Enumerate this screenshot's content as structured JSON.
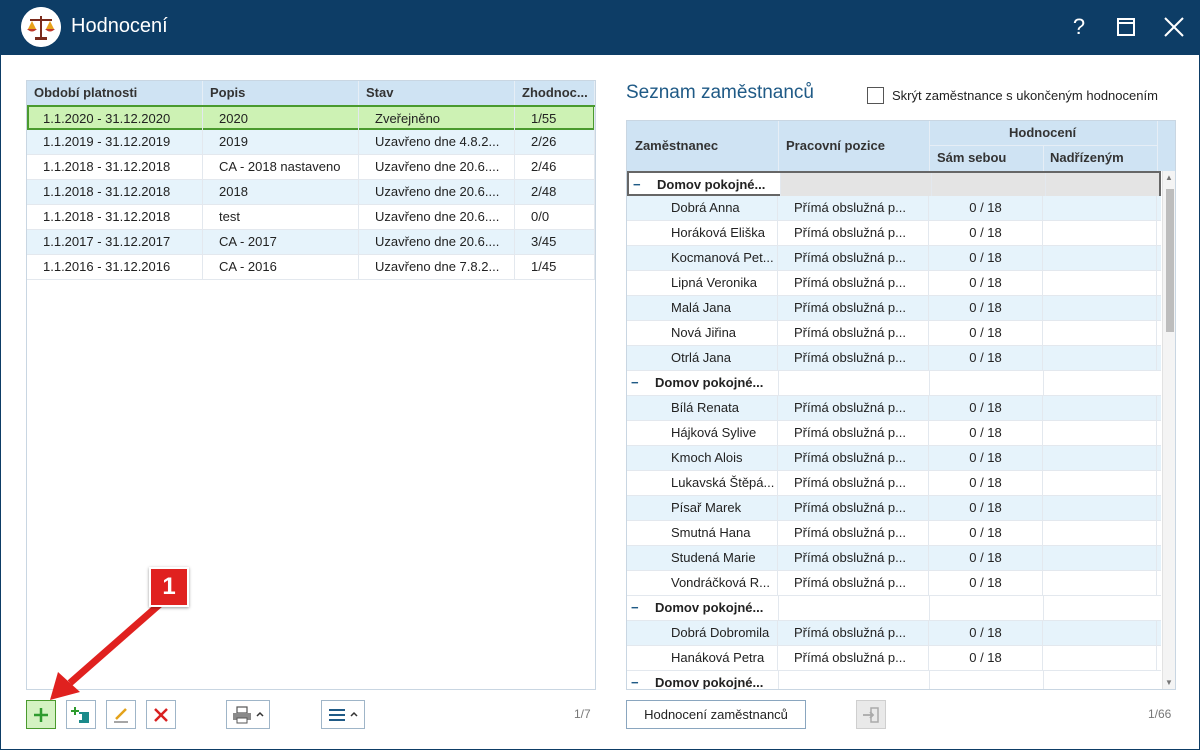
{
  "window": {
    "title": "Hodnocení",
    "help_label": "?",
    "colors": {
      "titlebar": "#0d3d66",
      "accent": "#1f5a86",
      "selected_row": "#cdf2b4",
      "alt_row": "#e6f3fb",
      "annotation": "#e0211f"
    }
  },
  "left_grid": {
    "columns": [
      "Období platnosti",
      "Popis",
      "Stav",
      "Zhodnoc..."
    ],
    "rows": [
      {
        "period": "1.1.2020 - 31.12.2020",
        "desc": "2020",
        "state": "Zveřejněno",
        "score": "1/55"
      },
      {
        "period": "1.1.2019 - 31.12.2019",
        "desc": "2019",
        "state": "Uzavřeno dne 4.8.2...",
        "score": "2/26"
      },
      {
        "period": "1.1.2018 - 31.12.2018",
        "desc": "CA - 2018 nastaveno",
        "state": "Uzavřeno dne 20.6....",
        "score": "2/46"
      },
      {
        "period": "1.1.2018 - 31.12.2018",
        "desc": "2018",
        "state": "Uzavřeno dne 20.6....",
        "score": "2/48"
      },
      {
        "period": "1.1.2018 - 31.12.2018",
        "desc": "test",
        "state": "Uzavřeno dne 20.6....",
        "score": "0/0"
      },
      {
        "period": "1.1.2017 - 31.12.2017",
        "desc": "CA - 2017",
        "state": "Uzavřeno dne 20.6....",
        "score": "3/45"
      },
      {
        "period": "1.1.2016 - 31.12.2016",
        "desc": "CA - 2016",
        "state": "Uzavřeno dne 7.8.2...",
        "score": "1/45"
      }
    ],
    "counter": "1/7"
  },
  "left_toolbar": {
    "icons": [
      "add-icon",
      "copy-add-icon",
      "edit-icon",
      "delete-icon",
      "print-icon",
      "menu-icon"
    ]
  },
  "right_panel": {
    "title": "Seznam zaměstnanců",
    "checkbox_label": "Skrýt zaměstnance s ukončeným hodnocením",
    "columns": {
      "employee": "Zaměstnanec",
      "position": "Pracovní pozice",
      "rating": "Hodnocení",
      "self": "Sám sebou",
      "supervisor": "Nadřízeným"
    },
    "groups": [
      {
        "name": "Domov pokojné...",
        "employees": [
          {
            "name": "Dobrá Anna",
            "position": "Přímá obslužná p...",
            "self": "0 / 18",
            "supervisor": ""
          },
          {
            "name": "Horáková Eliška",
            "position": "Přímá obslužná p...",
            "self": "0 / 18",
            "supervisor": ""
          },
          {
            "name": "Kocmanová Pet...",
            "position": "Přímá obslužná p...",
            "self": "0 / 18",
            "supervisor": ""
          },
          {
            "name": "Lipná Veronika",
            "position": "Přímá obslužná p...",
            "self": "0 / 18",
            "supervisor": ""
          },
          {
            "name": "Malá Jana",
            "position": "Přímá obslužná p...",
            "self": "0 / 18",
            "supervisor": ""
          },
          {
            "name": "Nová Jiřina",
            "position": "Přímá obslužná p...",
            "self": "0 / 18",
            "supervisor": ""
          },
          {
            "name": "Otrlá Jana",
            "position": "Přímá obslužná p...",
            "self": "0 / 18",
            "supervisor": ""
          }
        ]
      },
      {
        "name": "Domov pokojné...",
        "employees": [
          {
            "name": "Bílá Renata",
            "position": "Přímá obslužná p...",
            "self": "0 / 18",
            "supervisor": ""
          },
          {
            "name": "Hájková Sylive",
            "position": "Přímá obslužná p...",
            "self": "0 / 18",
            "supervisor": ""
          },
          {
            "name": "Kmoch Alois",
            "position": "Přímá obslužná p...",
            "self": "0 / 18",
            "supervisor": ""
          },
          {
            "name": "Lukavská Štěpá...",
            "position": "Přímá obslužná p...",
            "self": "0 / 18",
            "supervisor": ""
          },
          {
            "name": "Písař Marek",
            "position": "Přímá obslužná p...",
            "self": "0 / 18",
            "supervisor": ""
          },
          {
            "name": "Smutná Hana",
            "position": "Přímá obslužná p...",
            "self": "0 / 18",
            "supervisor": ""
          },
          {
            "name": "Studená Marie",
            "position": "Přímá obslužná p...",
            "self": "0 / 18",
            "supervisor": ""
          },
          {
            "name": "Vondráčková R...",
            "position": "Přímá obslužná p...",
            "self": "0 / 18",
            "supervisor": ""
          }
        ]
      },
      {
        "name": "Domov pokojné...",
        "employees": [
          {
            "name": "Dobrá Dobromila",
            "position": "Přímá obslužná p...",
            "self": "0 / 18",
            "supervisor": ""
          },
          {
            "name": "Hanáková Petra",
            "position": "Přímá obslužná p...",
            "self": "0 / 18",
            "supervisor": ""
          }
        ]
      },
      {
        "name": "Domov pokojné...",
        "employees": []
      }
    ],
    "button_label": "Hodnocení zaměstnanců",
    "counter": "1/66"
  },
  "annotation": {
    "label": "1"
  }
}
